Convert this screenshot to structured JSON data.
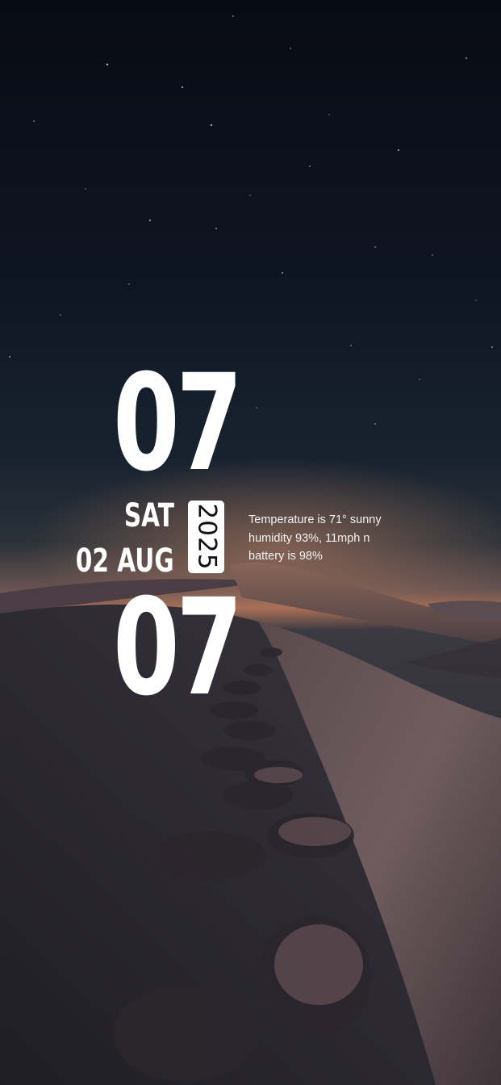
{
  "lockscreen": {
    "time": {
      "hour": "07",
      "minute": "07"
    },
    "date": {
      "weekday": "SAT",
      "day_month": "02 AUG",
      "year": "2025"
    },
    "info": {
      "line1": "Temperature is 71° sunny",
      "line2": "humidity 93%, 11mph n",
      "line3": "battery is 98%"
    }
  },
  "wallpaper": {
    "subject": "desert-dunes-night-sky",
    "colors": {
      "sky_top": "#0a0e17",
      "sky_mid": "#1a2536",
      "horizon": "#9c6a55",
      "dune": "#4e4147",
      "dune_light": "#7d6668"
    }
  }
}
